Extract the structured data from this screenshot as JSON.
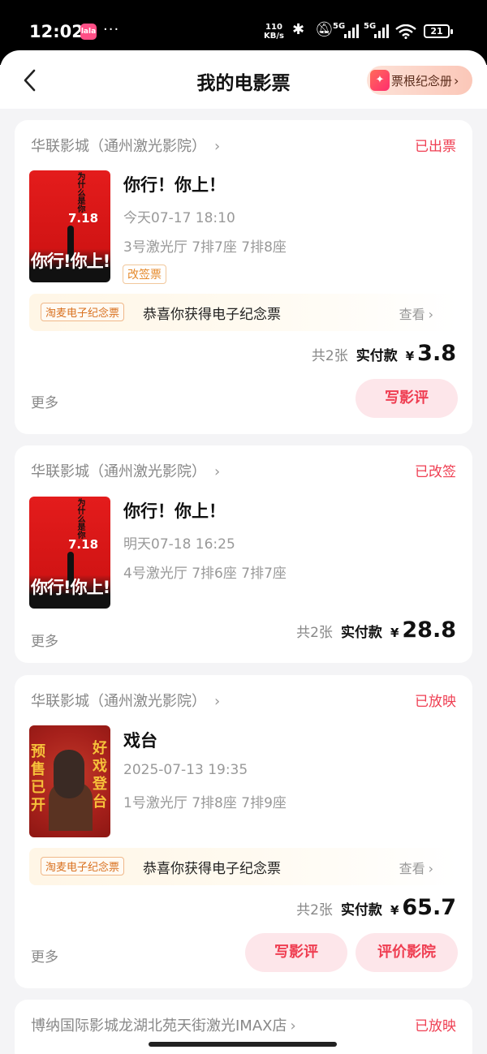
{
  "status_bar": {
    "time": "12:02",
    "app_badge": "lala",
    "dots": "···",
    "net_speed_value": "110",
    "net_speed_unit": "KB/s",
    "net_a": "5G",
    "net_b": "5G",
    "battery": "21"
  },
  "header": {
    "title": "我的电影票",
    "stub_button": "票根纪念册",
    "stub_icon_glyph": "✦"
  },
  "orders": [
    {
      "cinema": "华联影城（通州激光影院）",
      "status": "已出票",
      "movie": "你行！你上！",
      "showtime": "今天07-17 18:10",
      "seats": "3号激光厅 7排7座 7排8座",
      "tag": "改签票",
      "souvenir_tag": "淘麦电子纪念票",
      "souvenir_text": "恭喜你获得电子纪念票",
      "souvenir_link": "查看",
      "count": "共2张",
      "paid_label": "实付款",
      "currency": "¥",
      "amount": "3.8",
      "more": "更多",
      "buttons": [
        "写影评"
      ],
      "poster": {
        "top": "为什么是你",
        "date": "7.18",
        "title": "你行!你上!"
      }
    },
    {
      "cinema": "华联影城（通州激光影院）",
      "status": "已改签",
      "movie": "你行！你上！",
      "showtime": "明天07-18 16:25",
      "seats": "4号激光厅 7排6座 7排7座",
      "count": "共2张",
      "paid_label": "实付款",
      "currency": "¥",
      "amount": "28.8",
      "more": "更多",
      "poster": {
        "top": "为什么是你",
        "date": "7.18",
        "title": "你行!你上!"
      }
    },
    {
      "cinema": "华联影城（通州激光影院）",
      "status": "已放映",
      "movie": "戏台",
      "showtime": "2025-07-13 19:35",
      "seats": "1号激光厅 7排8座 7排9座",
      "souvenir_tag": "淘麦电子纪念票",
      "souvenir_text": "恭喜你获得电子纪念票",
      "souvenir_link": "查看",
      "count": "共2张",
      "paid_label": "实付款",
      "currency": "¥",
      "amount": "65.7",
      "more": "更多",
      "buttons": [
        "写影评",
        "评价影院"
      ],
      "poster": {
        "left": "预售已开",
        "right": "好戏登台"
      }
    },
    {
      "cinema": "博纳国际影城龙湖北苑天街激光IMAX店",
      "status": "已放映"
    }
  ],
  "colors": {
    "accent": "#ef3e52",
    "pill_bg": "#fde6ea",
    "page_bg": "#f4f4f6",
    "souvenir_orange": "#d9711f"
  }
}
